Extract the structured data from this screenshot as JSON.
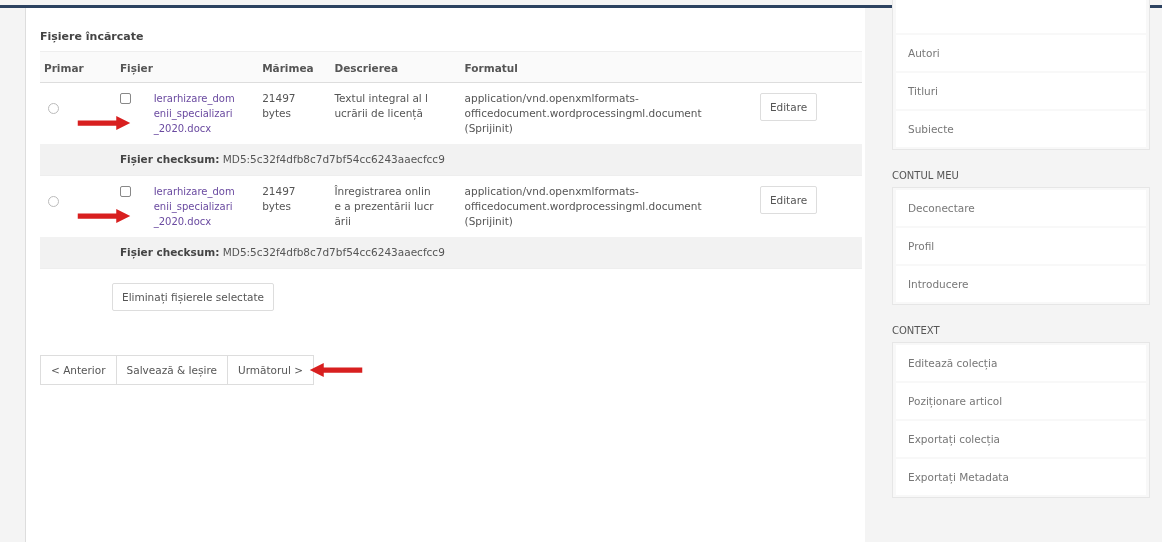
{
  "section_title": "Fișiere încărcate",
  "table": {
    "columns": [
      "Primar",
      "Fișier",
      "Mărimea",
      "Descrierea",
      "Formatul"
    ],
    "rows": [
      {
        "primary_selected": false,
        "checked": false,
        "file": "Ierarhizare_domenii_specializari_2020.docx",
        "size": "21497 bytes",
        "description": "Textul integral al lucrării de licență",
        "format": "application/vnd.openxmlformats-officedocument.wordprocessingml.document (Sprijinit)",
        "edit_button": "Editare",
        "checksum_label": "Fișier checksum:",
        "checksum": "MD5:5c32f4dfb8c7d7bf54cc6243aaecfcc9",
        "arrow": true
      },
      {
        "primary_selected": false,
        "checked": false,
        "file": "Ierarhizare_domenii_specializari_2020.docx",
        "size": "21497 bytes",
        "description": "Înregistrarea online a prezentării lucrării",
        "format": "application/vnd.openxmlformats-officedocument.wordprocessingml.document (Sprijinit)",
        "edit_button": "Editare",
        "checksum_label": "Fișier checksum:",
        "checksum": "MD5:5c32f4dfb8c7d7bf54cc6243aaecfcc9",
        "arrow": true
      }
    ]
  },
  "remove_button": "Eliminați fișierele selectate",
  "nav_buttons": [
    {
      "label": "< Anterior",
      "arrow": false
    },
    {
      "label": "Salvează & Ieșire",
      "arrow": false
    },
    {
      "label": "Următorul >",
      "arrow": true
    }
  ],
  "sidebar": [
    {
      "items": [
        "Autori",
        "Titluri",
        "Subiecte"
      ]
    },
    {
      "heading": "CONTUL MEU",
      "items": [
        "Deconectare",
        "Profil",
        "Introducere"
      ]
    },
    {
      "heading": "CONTEXT",
      "items": [
        "Editează colecția",
        "Poziționare articol",
        "Exportați colecția",
        "Exportați Metadata"
      ]
    }
  ]
}
